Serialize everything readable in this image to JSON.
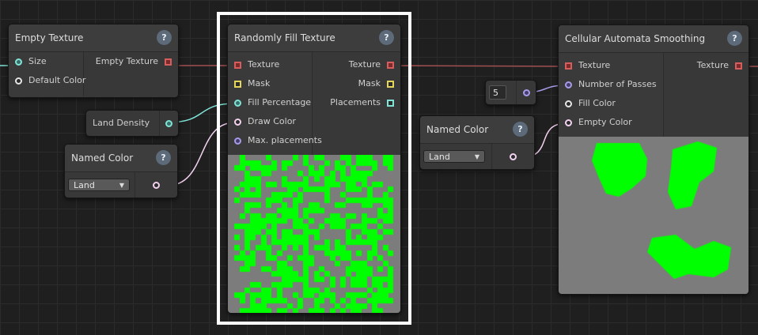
{
  "colors": {
    "background": "#1f1f1f",
    "node": "#383838",
    "green": "#00ff00",
    "preview_gray": "#7c7c7c",
    "texture_wire": "#a05050",
    "teal_wire": "#7fe3d6",
    "pink_wire": "#f3d2ef",
    "purple_wire": "#a89be8"
  },
  "empty_texture": {
    "title": "Empty Texture",
    "inputs": [
      {
        "label": "Size",
        "icon": "teal-circle"
      },
      {
        "label": "Default Color",
        "icon": "white-circle"
      }
    ],
    "outputs": [
      {
        "label": "Empty Texture",
        "icon": "red-square"
      }
    ]
  },
  "land_density": {
    "label": "Land Density"
  },
  "named_color_left": {
    "title": "Named Color",
    "selected": "Land"
  },
  "randomly_fill": {
    "title": "Randomly Fill Texture",
    "inputs": [
      {
        "label": "Texture",
        "icon": "red-square"
      },
      {
        "label": "Mask",
        "icon": "yellow-square"
      },
      {
        "label": "Fill Percentage",
        "icon": "teal-circle"
      },
      {
        "label": "Draw Color",
        "icon": "pink-circle"
      },
      {
        "label": "Max. placements",
        "icon": "purple-circle"
      }
    ],
    "outputs": [
      {
        "label": "Texture",
        "icon": "red-square"
      },
      {
        "label": "Mask",
        "icon": "yellow-square"
      },
      {
        "label": "Placements",
        "icon": "teal-square"
      }
    ]
  },
  "passes_value": {
    "value": "5"
  },
  "named_color_right": {
    "title": "Named Color",
    "selected": "Land"
  },
  "cellular": {
    "title": "Cellular Automata Smoothing",
    "inputs": [
      {
        "label": "Texture",
        "icon": "red-square"
      },
      {
        "label": "Number of Passes",
        "icon": "purple-circle"
      },
      {
        "label": "Fill Color",
        "icon": "white-circle"
      },
      {
        "label": "Empty Color",
        "icon": "pink-circle"
      }
    ],
    "outputs": [
      {
        "label": "Texture",
        "icon": "red-square"
      }
    ]
  },
  "help_label": "?"
}
